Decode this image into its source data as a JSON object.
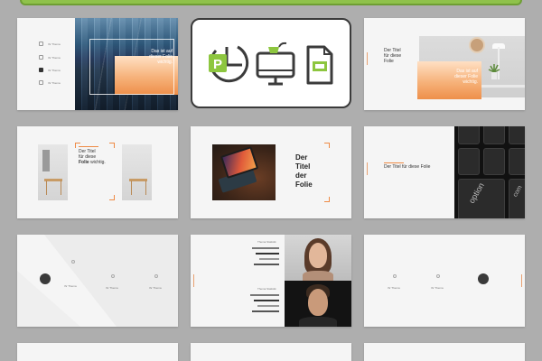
{
  "slides": {
    "s1": {
      "menu": [
        "Ihr Thema",
        "Ihr Thema",
        "Ihr Thema",
        "Ihr Thema"
      ],
      "headline": [
        "Das ist auf",
        "dieser Folie",
        "wichtig."
      ]
    },
    "s3": {
      "title": [
        "Der Titel",
        "für diese",
        "Folie"
      ],
      "headline": [
        "Das ist auf",
        "dieser Folie",
        "wichtig."
      ]
    },
    "s4": {
      "title_pre": "Der Titel",
      "title_line2": "für diese",
      "title_strong": "Folie",
      "title_after": "wichtig."
    },
    "s5": {
      "title": [
        "Der",
        "Titel",
        "der",
        "Folie"
      ]
    },
    "s6": {
      "title": "Der Titel für diese Folie",
      "key_labels": [
        "option",
        "com"
      ]
    },
    "s7": {
      "labels": [
        "Ihr Thema",
        "Ihr Thema",
        "Ihr Thema"
      ]
    },
    "s8": {
      "labels": [
        "Thema Statistik",
        "Thema Statistik"
      ]
    },
    "s9": {
      "labels": [
        "Ihr Thema",
        "Ihr Thema"
      ]
    }
  },
  "colors": {
    "background": "#aeaeae",
    "accent": "#ee8a45",
    "top_bar": "#8fc24b",
    "icon_green": "#8dc63f",
    "icon_dark": "#3b3b3b"
  },
  "icons": [
    "powerpoint-icon",
    "keynote-icon",
    "google-slides-icon"
  ]
}
